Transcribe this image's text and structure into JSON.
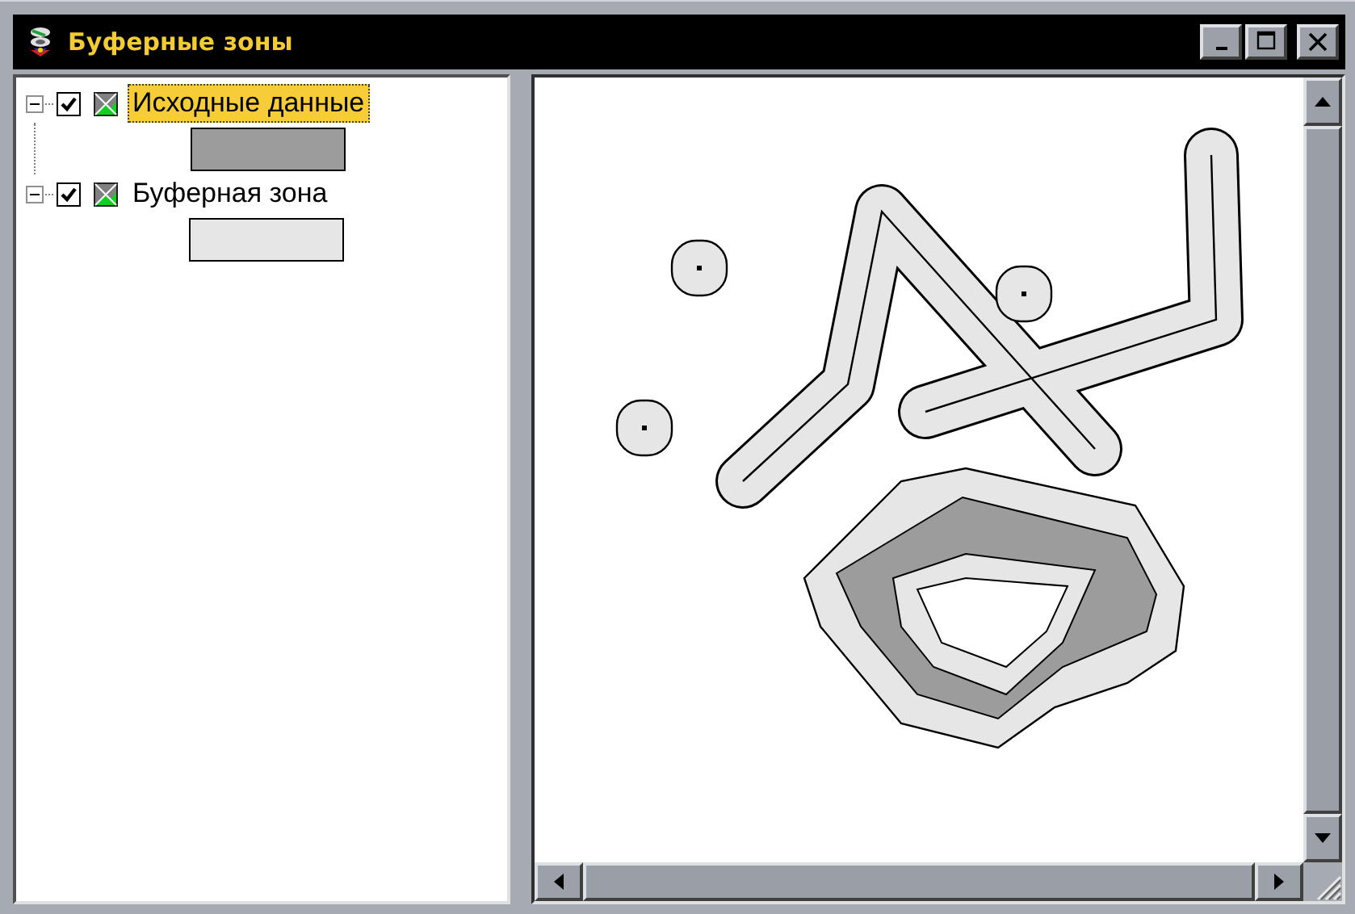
{
  "window": {
    "title": "Буферные зоны"
  },
  "layers": [
    {
      "label": "Исходные данные",
      "selected": true,
      "checked": true,
      "expanded": true,
      "color": "#9c9c9c"
    },
    {
      "label": "Буферная зона",
      "selected": false,
      "checked": true,
      "expanded": true,
      "color": "#e6e6e6"
    }
  ]
}
